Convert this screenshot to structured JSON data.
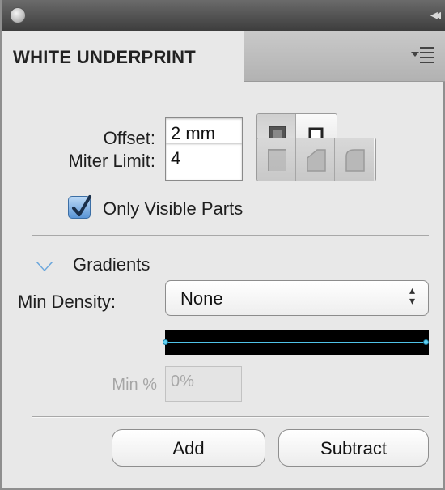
{
  "panel": {
    "tab_title": "WHITE UNDERPRINT",
    "collapse_glyph": "◂◂",
    "menu_icon": "panel-menu-icon"
  },
  "offset": {
    "label": "Offset:",
    "value": "2 mm",
    "mode_buttons": [
      "offset-fill-icon",
      "offset-outline-icon"
    ],
    "selected": 0
  },
  "miter": {
    "label": "Miter Limit:",
    "value": "4",
    "join_buttons": [
      "miter-join-icon",
      "round-join-icon",
      "bevel-join-icon"
    ]
  },
  "only_visible": {
    "label": "Only Visible Parts",
    "checked": true
  },
  "gradients": {
    "section_label": "Gradients",
    "expanded": true,
    "min_density_label": "Min Density:",
    "min_density_value": "None",
    "min_pct_label": "Min %",
    "min_pct_value": "0%"
  },
  "actions": {
    "add_label": "Add",
    "subtract_label": "Subtract"
  },
  "colors": {
    "accent": "#4fc3e8",
    "checkbox": "#5a95d6",
    "panel_bg": "#e8e8e8"
  }
}
